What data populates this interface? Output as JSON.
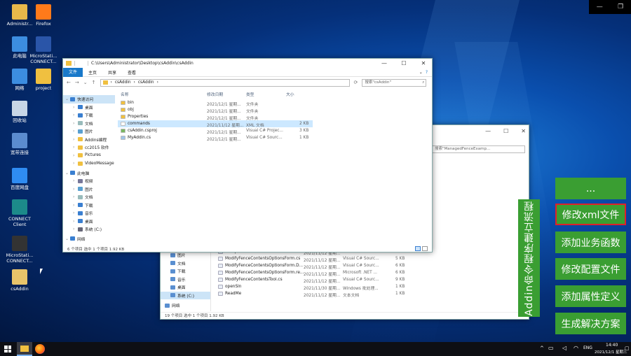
{
  "desktop": {
    "icons": [
      {
        "label": "Administr...",
        "icon": "user-folder-icon",
        "color": "#e8b84a"
      },
      {
        "label": "Firefox",
        "icon": "firefox-icon",
        "color": "#ff7a1a"
      },
      {
        "label": "此电脑",
        "icon": "this-pc-icon",
        "color": "#3c8de0"
      },
      {
        "label": "MicroStati... CONNECT...",
        "icon": "microstation-icon",
        "color": "#2a55a8"
      },
      {
        "label": "网络",
        "icon": "network-icon",
        "color": "#3c8de0"
      },
      {
        "label": "project",
        "icon": "folder-icon",
        "color": "#f0c040"
      },
      {
        "label": "回收站",
        "icon": "recycle-bin-icon",
        "color": "#c8d6e6"
      },
      {
        "label": "宽带连接",
        "icon": "broadband-icon",
        "color": "#5b8ccf"
      },
      {
        "label": "百度网盘",
        "icon": "baidu-netdisk-icon",
        "color": "#2f8cf2"
      },
      {
        "label": "CONNECT Client",
        "icon": "connect-client-icon",
        "color": "#1c8a8a"
      },
      {
        "label": "MicroStati... CONNECT...",
        "icon": "microstation-dark-icon",
        "color": "#333"
      },
      {
        "label": "csAddin",
        "icon": "csaddin-icon",
        "color": "#e8c46a"
      }
    ]
  },
  "explorer_front": {
    "title_path": "C:\\Users\\Administrator\\Desktop\\csAddin\\csAddin",
    "ribbon_tabs": [
      "文件",
      "主页",
      "共享",
      "查看"
    ],
    "breadcrumb": [
      "csAddin",
      "csAddin"
    ],
    "search_placeholder": "搜索\"csAddin\"",
    "columns": [
      "名称",
      "修改日期",
      "类型",
      "大小"
    ],
    "tree": [
      {
        "label": "快速访问",
        "level": 0,
        "icon": "star-icon"
      },
      {
        "label": "桌面",
        "level": 1,
        "icon": "desktop-icon"
      },
      {
        "label": "下载",
        "level": 1,
        "icon": "download-icon"
      },
      {
        "label": "文档",
        "level": 1,
        "icon": "document-icon"
      },
      {
        "label": "图片",
        "level": 1,
        "icon": "picture-icon"
      },
      {
        "label": "Addins编程",
        "level": 1,
        "icon": "folder-icon"
      },
      {
        "label": "cc2015 软件",
        "level": 1,
        "icon": "folder-icon"
      },
      {
        "label": "Pictures",
        "level": 1,
        "icon": "folder-icon"
      },
      {
        "label": "VideoMessage",
        "level": 1,
        "icon": "folder-icon"
      },
      {
        "label": "此电脑",
        "level": 0,
        "icon": "this-pc-icon"
      },
      {
        "label": "视频",
        "level": 1,
        "icon": "video-icon"
      },
      {
        "label": "图片",
        "level": 1,
        "icon": "picture-icon"
      },
      {
        "label": "文档",
        "level": 1,
        "icon": "document-icon"
      },
      {
        "label": "下载",
        "level": 1,
        "icon": "download-icon"
      },
      {
        "label": "音乐",
        "level": 1,
        "icon": "music-icon"
      },
      {
        "label": "桌面",
        "level": 1,
        "icon": "desktop-icon"
      },
      {
        "label": "系统 (C:)",
        "level": 1,
        "icon": "drive-icon"
      },
      {
        "label": "网络",
        "level": 0,
        "icon": "network-icon"
      }
    ],
    "files": [
      {
        "name": "bin",
        "date": "2021/12/1 星期...",
        "type": "文件夹",
        "size": "",
        "selected": false,
        "icon": "folder-icon"
      },
      {
        "name": "obj",
        "date": "2021/12/1 星期...",
        "type": "文件夹",
        "size": "",
        "selected": false,
        "icon": "folder-icon"
      },
      {
        "name": "Properties",
        "date": "2021/12/1 星期...",
        "type": "文件夹",
        "size": "",
        "selected": false,
        "icon": "folder-icon"
      },
      {
        "name": "commands",
        "date": "2021/11/12 星期...",
        "type": "XML 文档",
        "size": "2 KB",
        "selected": true,
        "icon": "xml-file-icon"
      },
      {
        "name": "csAddin.csproj",
        "date": "2021/12/1 星期...",
        "type": "Visual C# Projec...",
        "size": "3 KB",
        "selected": false,
        "icon": "csproj-file-icon"
      },
      {
        "name": "MyAddin.cs",
        "date": "2021/12/1 星期...",
        "type": "Visual C# Sourc...",
        "size": "1 KB",
        "selected": false,
        "icon": "cs-file-icon"
      }
    ],
    "status": "6 个项目   选中 1 个项目  1.92 KB"
  },
  "explorer_back": {
    "search_placeholder": "搜索\"ManagedFenceExamp...",
    "tree": [
      {
        "label": "图片",
        "icon": "picture-icon"
      },
      {
        "label": "文档",
        "icon": "document-icon"
      },
      {
        "label": "下载",
        "icon": "download-icon"
      },
      {
        "label": "音乐",
        "icon": "music-icon"
      },
      {
        "label": "桌面",
        "icon": "desktop-icon"
      },
      {
        "label": "系统 (C:)",
        "icon": "drive-icon"
      },
      {
        "label": "网络",
        "icon": "network-icon"
      }
    ],
    "files": [
      {
        "name": "ManipulateFenceContentsTool.cs",
        "date": "2021/11/12 星期...",
        "type": "Visual C# Sourc...",
        "size": "6 KB"
      },
      {
        "name": "ModifyFenceContentsOptionsForm.cs",
        "date": "2021/11/12 星期...",
        "type": "Visual C# Sourc...",
        "size": "5 KB"
      },
      {
        "name": "ModifyFenceContentsOptionsForm.D...",
        "date": "2021/11/12 星期...",
        "type": "Visual C# Sourc...",
        "size": "6 KB"
      },
      {
        "name": "ModifyFenceContentsOptionsForm.re...",
        "date": "2021/11/12 星期...",
        "type": "Microsoft .NET ...",
        "size": "6 KB"
      },
      {
        "name": "ModifyFenceContentsTool.cs",
        "date": "2021/11/12 星期...",
        "type": "Visual C# Sourc...",
        "size": "9 KB"
      },
      {
        "name": "openSln",
        "date": "2021/11/30 星期...",
        "type": "Windows 批处理...",
        "size": "1 KB"
      },
      {
        "name": "ReadMe",
        "date": "2021/11/12 星期...",
        "type": "文本文档",
        "size": "1 KB"
      }
    ],
    "status": "19 个项目   选中 1 个项目  1.92 KB"
  },
  "side_panel": {
    "vertical_title": "Addin命令程序建立流程",
    "buttons": [
      {
        "label": "...",
        "highlight": false
      },
      {
        "label": "修改xml文件",
        "highlight": true
      },
      {
        "label": "添加业务函数",
        "highlight": false
      },
      {
        "label": "修改配置文件",
        "highlight": false
      },
      {
        "label": "添加属性定义",
        "highlight": false
      },
      {
        "label": "生成解决方案",
        "highlight": false
      }
    ],
    "accent": "#3a9e32",
    "highlight_color": "#e0202a"
  },
  "taskbar": {
    "time": "14:40",
    "date": "2021/12/1 星期三",
    "ime": "ENG"
  },
  "window_controls": {
    "minimize": "—",
    "restore": "❐"
  }
}
